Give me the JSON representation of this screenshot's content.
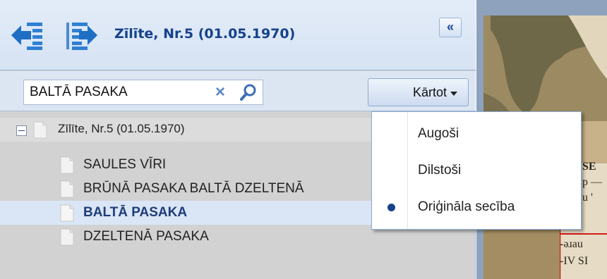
{
  "header": {
    "title": "Zīlīte, Nr.5 (01.05.1970)",
    "collapse_label": "«",
    "icons": [
      "outdent-arrow-left-icon",
      "indent-arrow-right-icon"
    ]
  },
  "toolbar": {
    "search_value": "BALTĀ PASAKA",
    "clear_label": "×",
    "sort_label": "Kārtot"
  },
  "tree": {
    "root": {
      "label": "Zīlīte, Nr.5 (01.05.1970)",
      "expanded": true
    },
    "items": [
      {
        "label": "SAULES VĪRI",
        "selected": false
      },
      {
        "label": "BRŪNĀ PASAKA BALTĀ DZELTENĀ",
        "selected": false
      },
      {
        "label": "BALTĀ PASAKA",
        "selected": true
      },
      {
        "label": "DZELTENĀ PASAKA",
        "selected": false
      }
    ]
  },
  "sort_menu": {
    "items": [
      {
        "label": "Augoši",
        "checked": false
      },
      {
        "label": "Dilstoši",
        "checked": false
      },
      {
        "label": "Oriģināla secība",
        "checked": true
      }
    ]
  },
  "scan_text": {
    "lines": [
      "SE",
      "p —",
      "u '",
      "-ǝɹau",
      "-IV SI"
    ]
  },
  "colors": {
    "accent": "#15428b",
    "header_bg": "#dce6f3",
    "selected_row": "#dae6f6",
    "tree_bg": "#d2d2d2"
  }
}
